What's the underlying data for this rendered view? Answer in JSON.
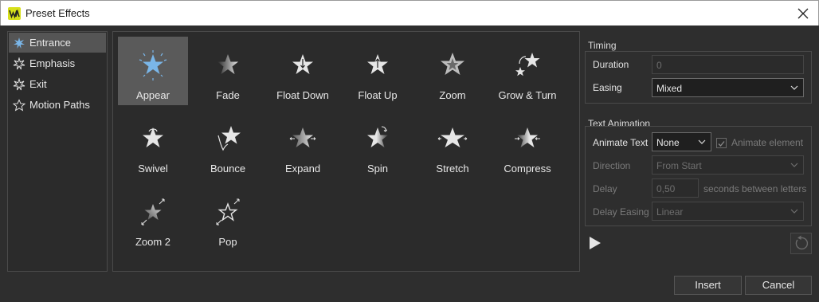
{
  "window": {
    "title": "Preset Effects"
  },
  "categories": [
    {
      "label": "Entrance",
      "icon": "star-burst-icon",
      "active": true
    },
    {
      "label": "Emphasis",
      "icon": "star-outline-icon",
      "active": false
    },
    {
      "label": "Exit",
      "icon": "star-outline-icon",
      "active": false
    },
    {
      "label": "Motion Paths",
      "icon": "star-outline-icon",
      "active": false
    }
  ],
  "effects": [
    {
      "label": "Appear",
      "icon": "appear-star-icon"
    },
    {
      "label": "Fade",
      "icon": "fade-star-icon"
    },
    {
      "label": "Float Down",
      "icon": "float-down-star-icon"
    },
    {
      "label": "Float Up",
      "icon": "float-up-star-icon"
    },
    {
      "label": "Zoom",
      "icon": "zoom-star-icon"
    },
    {
      "label": "Grow & Turn",
      "icon": "grow-turn-star-icon"
    },
    {
      "label": "Swivel",
      "icon": "swivel-star-icon"
    },
    {
      "label": "Bounce",
      "icon": "bounce-star-icon"
    },
    {
      "label": "Expand",
      "icon": "expand-star-icon"
    },
    {
      "label": "Spin",
      "icon": "spin-star-icon"
    },
    {
      "label": "Stretch",
      "icon": "stretch-star-icon"
    },
    {
      "label": "Compress",
      "icon": "compress-star-icon"
    },
    {
      "label": "Zoom 2",
      "icon": "zoom2-star-icon"
    },
    {
      "label": "Pop",
      "icon": "pop-star-icon"
    }
  ],
  "timing": {
    "title": "Timing",
    "duration_label": "Duration",
    "duration_value": "0",
    "easing_label": "Easing",
    "easing_value": "Mixed"
  },
  "text_animation": {
    "title": "Text Animation",
    "animate_text_label": "Animate Text",
    "animate_text_value": "None",
    "animate_element_label": "Animate element",
    "animate_element_checked": true,
    "direction_label": "Direction",
    "direction_value": "From Start",
    "delay_label": "Delay",
    "delay_value": "0,50",
    "delay_suffix": "seconds between letters",
    "delay_easing_label": "Delay Easing",
    "delay_easing_value": "Linear"
  },
  "buttons": {
    "insert": "Insert",
    "cancel": "Cancel"
  },
  "colors": {
    "accent_icon": "#7ab6e8",
    "brand": "#d7e01b"
  }
}
